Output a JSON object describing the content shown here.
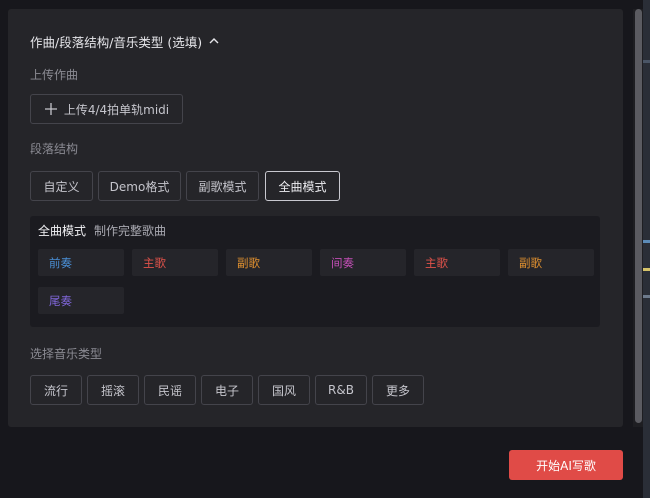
{
  "section": {
    "title": "作曲/段落结构/音乐类型 (选填)",
    "icon": "chevron-up-icon"
  },
  "upload": {
    "label": "上传作曲",
    "button_label": "上传4/4拍单轨midi",
    "icon": "plus-icon"
  },
  "structure": {
    "label": "段落结构",
    "options": [
      "自定义",
      "Demo格式",
      "副歌模式",
      "全曲模式"
    ],
    "selected": "全曲模式"
  },
  "mode": {
    "title": "全曲模式",
    "description": "制作完整歌曲",
    "segments": [
      {
        "label": "前奏",
        "color": "#4a8fd6"
      },
      {
        "label": "主歌",
        "color": "#e0524a"
      },
      {
        "label": "副歌",
        "color": "#e0902f"
      },
      {
        "label": "间奏",
        "color": "#c24fb5"
      },
      {
        "label": "主歌",
        "color": "#e0524a"
      },
      {
        "label": "副歌",
        "color": "#e0902f"
      },
      {
        "label": "尾奏",
        "color": "#7f66d8"
      }
    ]
  },
  "genre": {
    "label": "选择音乐类型",
    "options": [
      "流行",
      "摇滚",
      "民谣",
      "电子",
      "国风",
      "R&B",
      "更多"
    ]
  },
  "start_button": {
    "label": "开始AI写歌",
    "color": "#e04b47"
  }
}
